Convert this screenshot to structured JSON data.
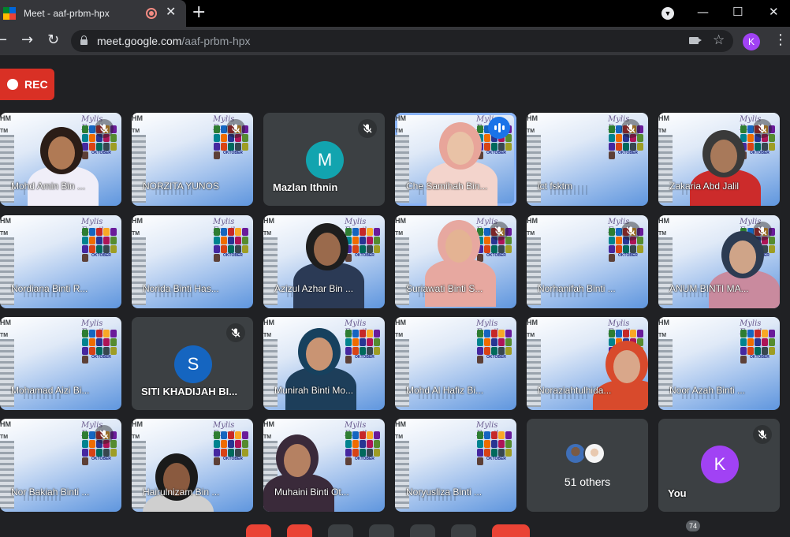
{
  "browser": {
    "tab_title": "Meet - aaf-prbm-hpx",
    "tab_close": "✕",
    "new_tab": "+",
    "url_host": "meet.google.com",
    "url_path": "/aaf-prbm-hpx",
    "profile_initial": "K",
    "window_controls": [
      "—",
      "☐",
      "✕"
    ]
  },
  "recording": {
    "label": "REC",
    "color": "#d93025"
  },
  "tiles": [
    {
      "name": "Mohd Amin Bin ...",
      "muted": true
    },
    {
      "name": "NORZITA YUNOS",
      "muted": true
    },
    {
      "name": "Mazlan Ithnin",
      "muted": true,
      "initial": "M",
      "initial_color": "#12a4af"
    },
    {
      "name": "Che Samihah Bin...",
      "speaking": true
    },
    {
      "name": "ict fsktm",
      "muted": true
    },
    {
      "name": "Zakaria Abd Jalil",
      "muted": true
    },
    {
      "name": "Nordiana Binti R...",
      "muted": false
    },
    {
      "name": "Norida Binti Has...",
      "muted": false
    },
    {
      "name": "Azizul Azhar Bin ...",
      "muted": false
    },
    {
      "name": "Suriawati Binti S...",
      "muted": true
    },
    {
      "name": "Norhanifah Binti ...",
      "muted": true
    },
    {
      "name": "ANUM BINTI MA...",
      "muted": true
    },
    {
      "name": "Mohamad Aizi Bi...",
      "muted": false
    },
    {
      "name": "SITI KHADIJAH BI...",
      "muted": true,
      "initial": "S",
      "initial_color": "#1565c0"
    },
    {
      "name": "Munirah Binti Mo...",
      "muted": false
    },
    {
      "name": "Mohd Al Hafiz Bi...",
      "muted": false
    },
    {
      "name": "Noraziahtulhida...",
      "muted": false
    },
    {
      "name": "Noor Azah Binti ...",
      "muted": false
    },
    {
      "name": "Nor Bakiah Binti ...",
      "muted": true
    },
    {
      "name": "Hairulnizam Bin ...",
      "muted": false
    },
    {
      "name": "Muhaini Binti Ot...",
      "muted": false
    },
    {
      "name": "Noryusliza Binti ...",
      "muted": false
    }
  ],
  "others": {
    "label": "51 others"
  },
  "self": {
    "name": "You",
    "initial": "K",
    "initial_color": "#a142f4",
    "muted": true
  },
  "participant_count": "74",
  "colors": {
    "page_bg": "#202124",
    "tile_bg": "#3c4043",
    "accent_blue": "#1a73e8"
  }
}
